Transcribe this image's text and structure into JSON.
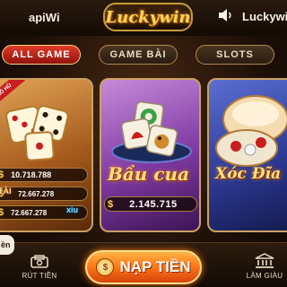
{
  "header": {
    "username": "apiWi",
    "logo_text": "Luckywin",
    "brand": "Luckywin",
    "sound_icon": "speaker-icon"
  },
  "tabs": [
    {
      "label": "ALL GAME",
      "active": true
    },
    {
      "label": "GAME BÀI",
      "active": false
    },
    {
      "label": "SLOTS",
      "active": false
    }
  ],
  "cards": {
    "tai_xiu": {
      "ribbon": "NỔ HŨ",
      "jackpots": [
        {
          "currency": "$",
          "value": "10.718.788"
        },
        {
          "currency": "$",
          "value": "72.667.278"
        },
        {
          "currency": "$",
          "value": "72.667.278"
        }
      ],
      "tai_label": "TÀI",
      "xiu_label": "xỉu"
    },
    "bau_cua": {
      "title": "Bầu cua",
      "jackpot": {
        "currency": "$",
        "value": "2.145.715"
      }
    },
    "xoc_dia": {
      "title": "Xóc Đĩa"
    }
  },
  "bottom": {
    "side_label": "ền",
    "withdraw_label": "RÚT TIỀN",
    "deposit_label": "NẠP TIỀN",
    "agency_label": "LÀM GIÀU"
  },
  "colors": {
    "accent_gold": "#ffd25c",
    "active_tab": "#e23a2a",
    "deposit": "#ff7a1a"
  }
}
